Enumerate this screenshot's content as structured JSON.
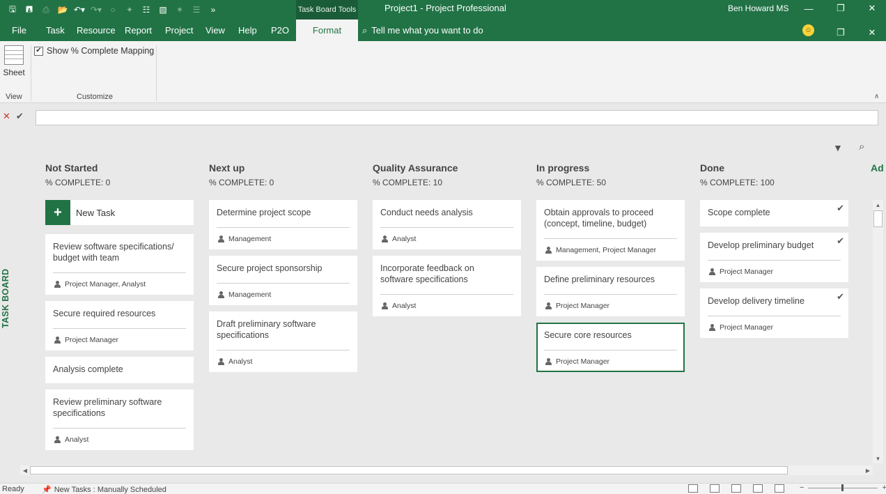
{
  "window": {
    "contextual_tab": "Task Board Tools",
    "title": "Project1  -  Project Professional",
    "user": "Ben Howard MS"
  },
  "menu": {
    "items": [
      "File",
      "Task",
      "Resource",
      "Report",
      "Project",
      "View",
      "Help",
      "P2O",
      "Format"
    ],
    "active": "Format",
    "tell_me": "Tell me what you want to do"
  },
  "ribbon": {
    "sheet_label": "Sheet",
    "view_group": "View",
    "checkbox_label": "Show % Complete Mapping",
    "checkbox_checked": true,
    "customize_group": "Customize"
  },
  "board": {
    "side_label": "TASK BOARD",
    "add_column": "Ad",
    "new_task": "New Task",
    "columns": [
      {
        "title": "Not Started",
        "pct": "% COMPLETE: 0",
        "cards": [
          {
            "title": "Review software specifications/ budget with team",
            "resource": "Project Manager, Analyst"
          },
          {
            "title": "Secure required resources",
            "resource": "Project Manager"
          },
          {
            "title": "Analysis complete",
            "resource": ""
          },
          {
            "title": "Review preliminary software specifications",
            "resource": "Analyst"
          }
        ]
      },
      {
        "title": "Next up",
        "pct": "% COMPLETE: 0",
        "cards": [
          {
            "title": "Determine project scope",
            "resource": "Management"
          },
          {
            "title": "Secure project sponsorship",
            "resource": "Management"
          },
          {
            "title": "Draft preliminary software specifications",
            "resource": "Analyst"
          }
        ]
      },
      {
        "title": "Quality Assurance",
        "pct": "% COMPLETE: 10",
        "cards": [
          {
            "title": "Conduct needs analysis",
            "resource": "Analyst"
          },
          {
            "title": "Incorporate feedback on software specifications",
            "resource": "Analyst"
          }
        ]
      },
      {
        "title": "In progress",
        "pct": "% COMPLETE: 50",
        "cards": [
          {
            "title": "Obtain approvals to proceed (concept, timeline, budget)",
            "resource": "Management, Project Manager"
          },
          {
            "title": "Define preliminary resources",
            "resource": "Project Manager"
          },
          {
            "title": "Secure core resources",
            "resource": "Project Manager",
            "selected": true
          }
        ]
      },
      {
        "title": "Done",
        "pct": "% COMPLETE: 100",
        "cards": [
          {
            "title": "Scope complete",
            "resource": "",
            "done": true
          },
          {
            "title": "Develop preliminary budget",
            "resource": "Project Manager",
            "done": true
          },
          {
            "title": "Develop delivery timeline",
            "resource": "Project Manager",
            "done": true
          }
        ]
      }
    ]
  },
  "status": {
    "ready": "Ready",
    "new_tasks": "New Tasks : Manually Scheduled"
  },
  "colors": {
    "accent": "#217346",
    "board_bg": "#e9e9e9"
  }
}
